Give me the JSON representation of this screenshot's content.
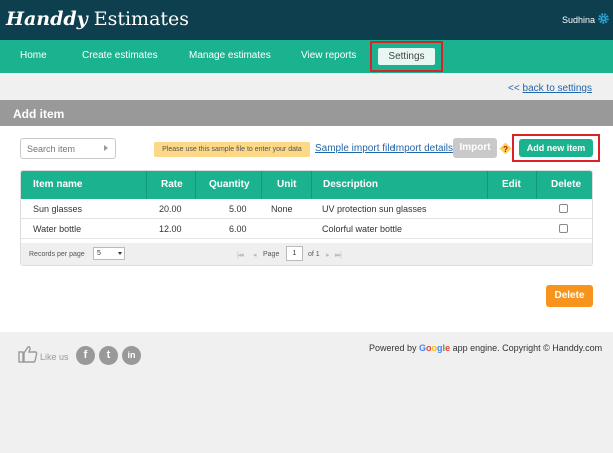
{
  "header": {
    "logo_brand": "Handdy",
    "logo_rest": " Estimates",
    "user_name": "Sudhina",
    "settings_icon": "gear-icon"
  },
  "nav": {
    "home": "Home",
    "create": "Create estimates",
    "manage": "Manage estimates",
    "reports": "View reports",
    "settings": "Settings"
  },
  "back_link": {
    "arrow": "<<",
    "label": "back to settings"
  },
  "page": {
    "title": "Add item"
  },
  "toolbar": {
    "search_placeholder": "Search item",
    "sample_note": "Please use this sample file to enter your data",
    "sample_import": "Sample import file",
    "import_details": "Import details",
    "import_label": "Import",
    "help_icon": "question-icon",
    "add_new_label": "Add new item"
  },
  "table": {
    "columns": [
      "Item name",
      "Rate",
      "Quantity",
      "Unit",
      "Description",
      "Edit",
      "Delete"
    ],
    "rows": [
      {
        "name": "Sun glasses",
        "rate": "20.00",
        "quantity": "5.00",
        "unit": "None",
        "description": "UV protection sun glasses"
      },
      {
        "name": "Water bottle",
        "rate": "12.00",
        "quantity": "6.00",
        "unit": "",
        "description": "Colorful water bottle"
      }
    ]
  },
  "pagination": {
    "records_label": "Records per page",
    "records_value": "5",
    "page_label": "Page",
    "page_value": "1",
    "of_label": "of 1"
  },
  "actions": {
    "delete_label": "Delete"
  },
  "footer": {
    "like_label": "Like us",
    "facebook": "f",
    "twitter": "t",
    "linkedin": "in",
    "powered_prefix": "Powered by ",
    "google": "Google",
    "powered_suffix": " app engine. Copyright © Handdy.com"
  },
  "colors": {
    "topbar": "#0e3f4f",
    "accent": "#1bb38f",
    "highlight_border": "#d9222a",
    "delete": "#f7941d",
    "link": "#2266aa"
  }
}
